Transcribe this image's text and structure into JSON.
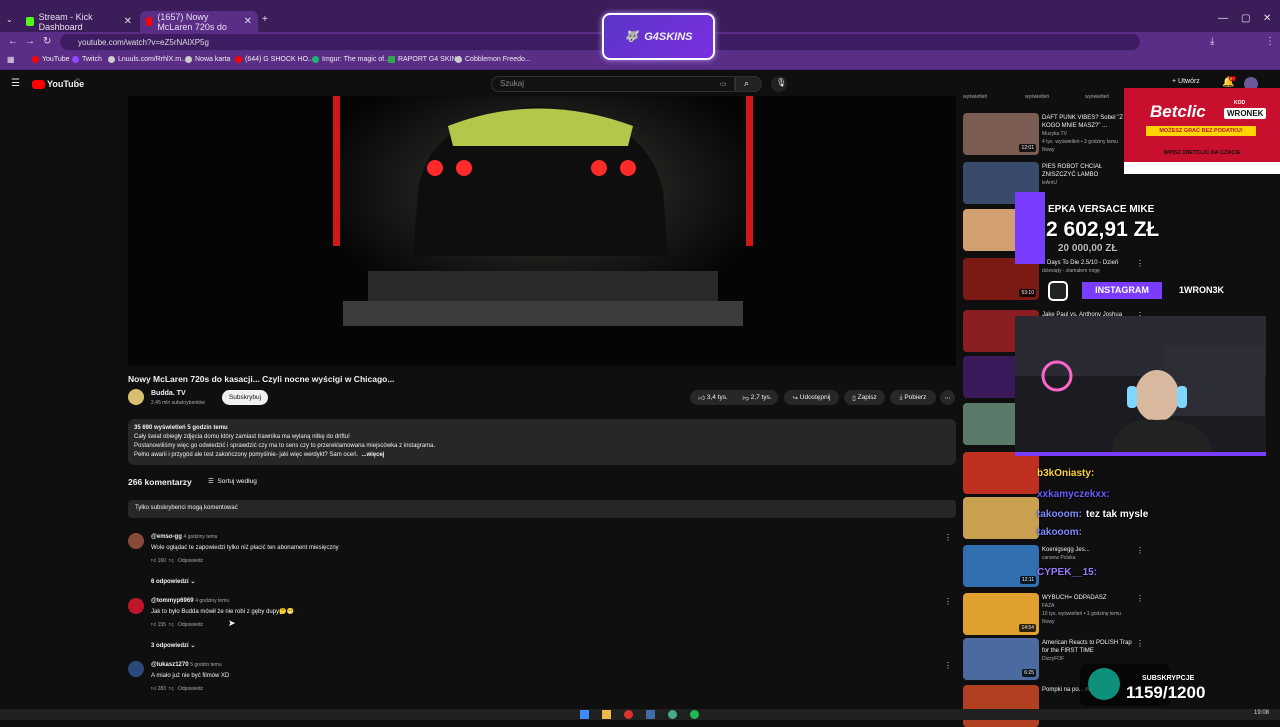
{
  "browser": {
    "tabs": [
      {
        "title": "Stream - Kick Dashboard",
        "favicon_color": "#53fc18"
      },
      {
        "title": "(1657) Nowy McLaren 720s do",
        "favicon_color": "#ff0000"
      }
    ],
    "url": "youtube.com/watch?v=eZ5rNAlXP5g",
    "bookmarks": [
      "YouTube",
      "Twitch",
      "Lnuuls.com/RrhlX.m...",
      "Nowa karta",
      "(644) G SHOCK HO...",
      "Imgur: The magic of...",
      "RAPORT G4 SKINS",
      "Cobblemon Freedo..."
    ]
  },
  "youtube": {
    "logo": "YouTube",
    "logo_region": "PL",
    "search_placeholder": "Szukaj",
    "create_label": "+ Utwórz",
    "notif_count": "9+"
  },
  "video": {
    "title": "Nowy McLaren 720s do kasacji... Czyli nocne wyścigi w Chicago...",
    "channel": "Budda. TV",
    "subs": "2,45 mln subskrybentów",
    "subscribe_label": "Subskrybuj",
    "likes": "3,4 tys.",
    "dislikes": "2,7 tys.",
    "share": "Udostępnij",
    "save": "Zapisz",
    "download": "Pobierz",
    "views_time": "35 690 wyświetleń  5 godzin temu",
    "desc_lines": [
      "Cały świat obiegły zdjęcia domu który zamiast trawnika ma wylaną nitkę do driftu!",
      "Postanowiliśmy więc go odwiedzić i sprawdzić czy ma to sens czy to przereklamowana miejscówka z instagrama.",
      "Pełno awarii i przygód ale test zakończony pomyślnie- jaki więc werdykt? Sam oceń."
    ],
    "more": "...więcej"
  },
  "comments": {
    "count": "266 komentarzy",
    "sort": "Sortuj według",
    "notice": "Tylko subskrybenci mogą komentować",
    "reply_label": "Odpowiedz",
    "items": [
      {
        "user": "@emso-gg",
        "time": "4 godziny temu",
        "text": "Wole oglądać te zapowiedzi tylko niż płacić ten abonament miesięczny",
        "likes": "160",
        "replies": "6 odpowiedzi",
        "color": "#8a4a3a"
      },
      {
        "user": "@tommyp6969",
        "time": "4 godziny temu",
        "text": "Jak to było Budda mówił że nie robi z gęby dupy🤔😁",
        "likes": "155",
        "replies": "3 odpowiedzi",
        "color": "#c0162b"
      },
      {
        "user": "@lukasz1270",
        "time": "5 godzin temu",
        "text": "A miało już nie być filmów XD",
        "likes": "283",
        "replies": "",
        "color": "#2a4a7a"
      }
    ]
  },
  "sidebar": {
    "header_words": [
      "wyświetleń",
      "wyświetleń",
      "wyświetleń"
    ],
    "items": [
      {
        "title": "DAFT PUNK VIBES? Sobel \"Z KOGO MNIE MASZ?\" ...",
        "meta": "Muzyka TV",
        "meta2": "4 tys. wyświetleń • 3 godziny temu",
        "badge": "Nowy",
        "dur": "12:01",
        "color": "#7a5c52"
      },
      {
        "title": "PIES ROBOT CHCIAŁ ZNISZCZYĆ LAMBO",
        "meta": "leAmU",
        "meta2": "",
        "badge": "",
        "dur": "",
        "color": "#3a4a6a"
      },
      {
        "title": "",
        "meta": "",
        "meta2": "",
        "badge": "",
        "dur": "",
        "color": "#d2a070"
      },
      {
        "title": "7 Days To Die 2.5/10 - Dzień",
        "meta": "dziesiąty - zlamałem nogę",
        "meta2": "",
        "badge": "",
        "dur": "53:10",
        "color": "#7a1a12"
      },
      {
        "title": "Jake Paul vs. Anthony Joshua",
        "meta": "",
        "meta2": "",
        "badge": "",
        "dur": "",
        "color": "#8a1e20"
      },
      {
        "title": "",
        "meta": "",
        "meta2": "",
        "badge": "",
        "dur": "",
        "color": "#3a1a5a"
      },
      {
        "title": "",
        "meta": "",
        "meta2": "",
        "badge": "",
        "dur": "",
        "color": "#5a7a6a"
      },
      {
        "title": "",
        "meta": "",
        "meta2": "",
        "badge": "",
        "dur": "",
        "color": "#c03020"
      },
      {
        "title": "",
        "meta": "",
        "meta2": "",
        "badge": "",
        "dur": "",
        "color": "#c8a050"
      },
      {
        "title": "Koenigsegg Jes...",
        "meta": "carwow Polska",
        "meta2": "",
        "badge": "",
        "dur": "12:11",
        "color": "#3070b0"
      },
      {
        "title": "WYBUCH= ODPADASZ",
        "meta": "FAZA",
        "meta2": "10 tys. wyświetleń • 1 godzinę temu",
        "badge": "Nowy",
        "dur": "14:54",
        "color": "#e0a030"
      },
      {
        "title": "American Reacts to POLISH Trap for the FIRST TIME",
        "meta": "DizzyFOF",
        "meta2": "",
        "badge": "",
        "dur": "6:25",
        "color": "#4a6aa0"
      },
      {
        "title": "Pompki na po... na głowie",
        "meta": "",
        "meta2": "",
        "badge": "",
        "dur": "",
        "color": "#b04020"
      }
    ]
  },
  "overlays": {
    "g4skins": "G4SKINS",
    "betclic_brand": "Betclic",
    "betclic_code_label": "KOD",
    "betclic_code": "WRONEK",
    "betclic_tag": "MOŻESZ GRAĆ BEZ PODATKU!",
    "betclic_bottom": "WPISZ 1BETCLIC NA CZACIE",
    "goal_name": "EPKA VERSACE MIKE",
    "goal_amount": "2 602,91 ZŁ",
    "goal_target": "20 000,00 ZŁ",
    "instagram": "INSTAGRAM",
    "instagram_handle": "1WRON3K",
    "subs_label": "SUBSKRYPCJE",
    "subs_value": "1159/1200",
    "chat": [
      {
        "user": "b3kOniasty:",
        "msg": "",
        "color": "#ffd43b"
      },
      {
        "user": "xxkamyczekxx:",
        "msg": "",
        "color": "#6b5cff"
      },
      {
        "user": "takooom:",
        "msg": "tez tak mysle",
        "color": "#7d8bff"
      },
      {
        "user": "takooom:",
        "msg": "",
        "color": "#7d8bff"
      },
      {
        "user": "CYPEK__15:",
        "msg": "",
        "color": "#9a7bff"
      }
    ]
  },
  "taskbar": {
    "time": "19:08"
  }
}
